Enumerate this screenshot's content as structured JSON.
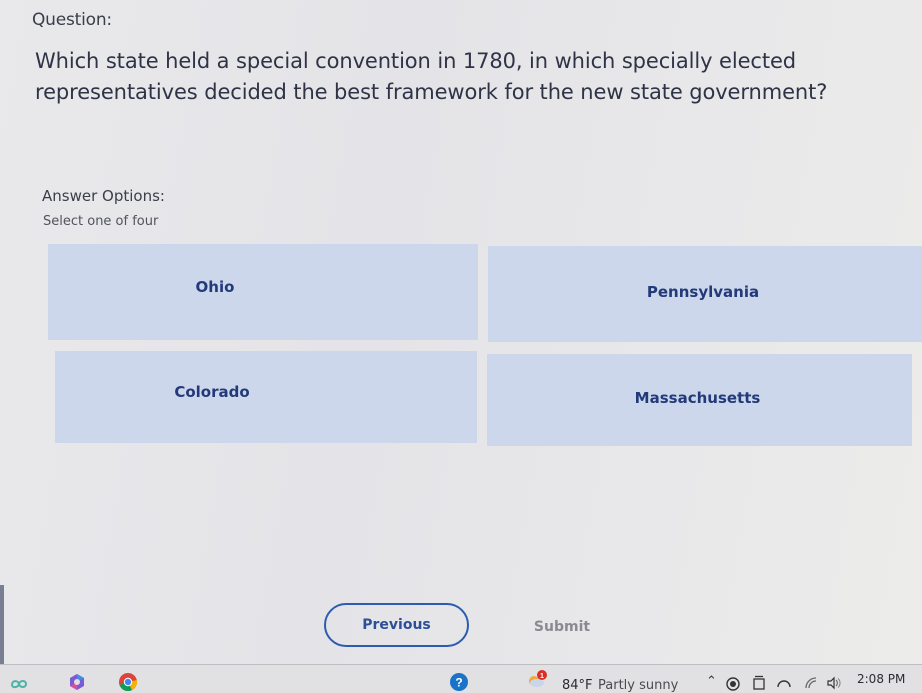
{
  "question": {
    "label": "Question:",
    "text": "Which state held a special convention in 1780, in which specially elected representatives decided the best framework for the new state government?"
  },
  "answers": {
    "label": "Answer Options:",
    "instruction": "Select one of four",
    "options": [
      {
        "label": "Ohio"
      },
      {
        "label": "Pennsylvania"
      },
      {
        "label": "Colorado"
      },
      {
        "label": "Massachusetts"
      }
    ]
  },
  "navigation": {
    "previous_label": "Previous",
    "submit_label": "Submit"
  },
  "taskbar": {
    "apps": [
      {
        "name": "infinity-app-icon"
      },
      {
        "name": "microsoft-365-icon"
      },
      {
        "name": "chrome-icon"
      },
      {
        "name": "help-icon"
      }
    ],
    "weather": {
      "temperature": "84°F",
      "condition": "Partly sunny",
      "badge_count": "1"
    },
    "clock": "2:08 PM"
  },
  "colors": {
    "option_background": "#ccd7eb",
    "option_text": "#233a7a",
    "accent": "#2b5cb0",
    "disabled_text": "#8a8b90"
  }
}
